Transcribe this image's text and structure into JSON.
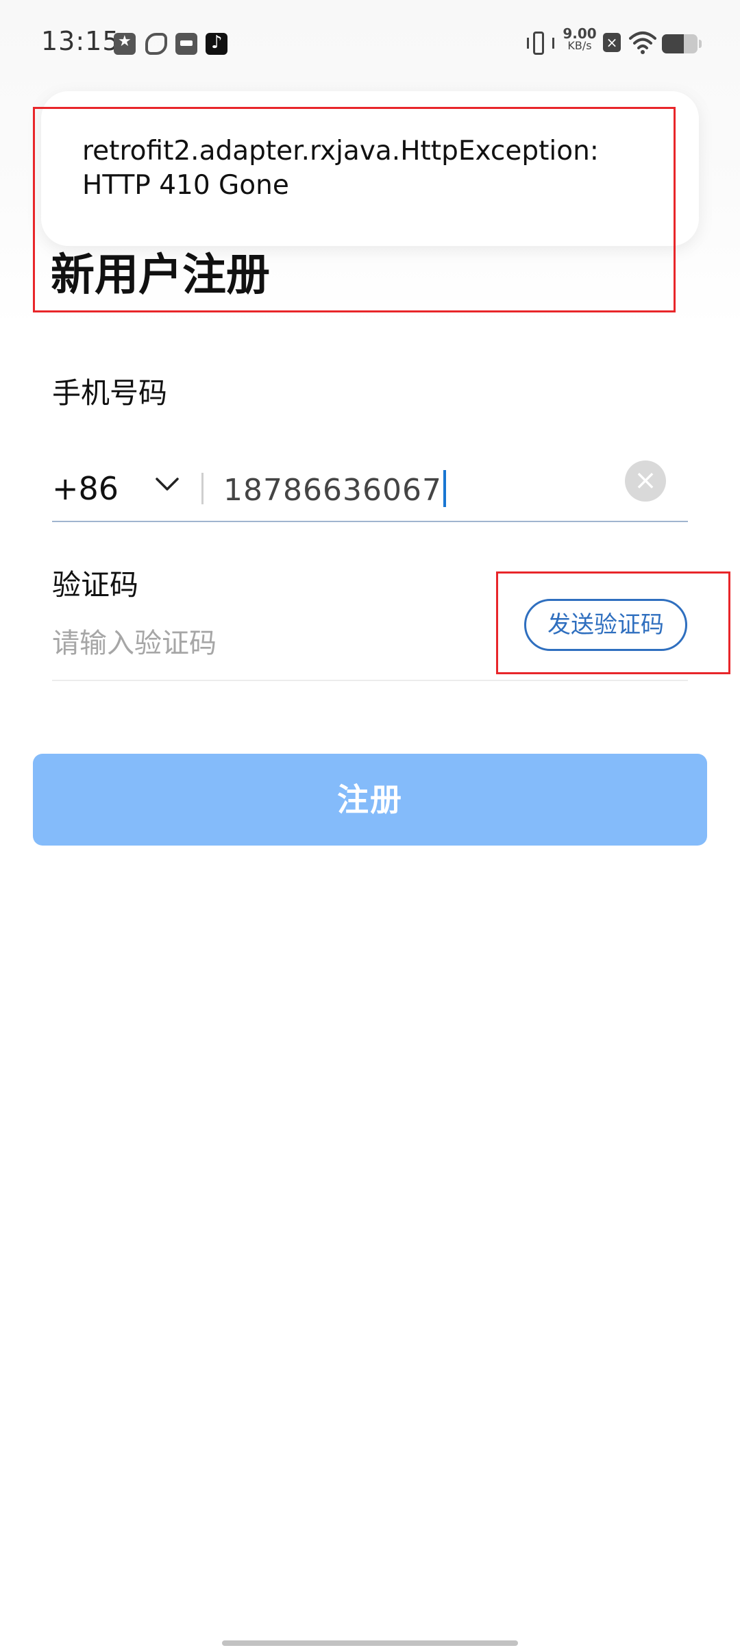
{
  "status_bar": {
    "time": "13:15",
    "net_speed_value": "9.00",
    "net_speed_unit": "KB/s",
    "battery_level": 0.62,
    "icons": [
      "star-notification-icon",
      "leaf-icon",
      "box-icon",
      "tiktok-icon",
      "vibrate-icon",
      "x-icon",
      "wifi-icon",
      "battery-icon"
    ]
  },
  "toast": {
    "message": "retrofit2.adapter.rxjava.HttpException: HTTP 410 Gone"
  },
  "page": {
    "title": "新用户注册"
  },
  "phone": {
    "label": "手机号码",
    "country_code": "+86",
    "value": "18786636067",
    "clear_symbol": "×"
  },
  "verification": {
    "label": "验证码",
    "placeholder": "请输入验证码",
    "send_button": "发送验证码"
  },
  "register_button": "注册",
  "colors": {
    "accent": "#2f6fbf",
    "register_button_bg": "#84bbfa",
    "annotation_red": "#e8262a",
    "cursor": "#1976d2"
  }
}
